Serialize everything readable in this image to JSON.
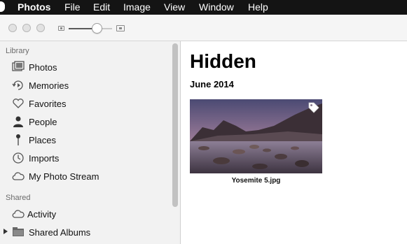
{
  "menubar": {
    "app_name": "Photos",
    "items": [
      "File",
      "Edit",
      "Image",
      "View",
      "Window",
      "Help"
    ]
  },
  "toolbar": {
    "zoom_level": 0.65
  },
  "sidebar": {
    "library_title": "Library",
    "library_items": [
      {
        "label": "Photos",
        "icon": "photos-icon"
      },
      {
        "label": "Memories",
        "icon": "memories-icon"
      },
      {
        "label": "Favorites",
        "icon": "heart-icon"
      },
      {
        "label": "People",
        "icon": "person-icon"
      },
      {
        "label": "Places",
        "icon": "pin-icon"
      },
      {
        "label": "Imports",
        "icon": "clock-icon"
      },
      {
        "label": "My Photo Stream",
        "icon": "cloud-icon"
      }
    ],
    "shared_title": "Shared",
    "shared_items": [
      {
        "label": "Activity",
        "icon": "cloud-icon"
      },
      {
        "label": "Shared Albums",
        "icon": "folder-icon"
      }
    ]
  },
  "main": {
    "title": "Hidden",
    "section_date": "June 2014",
    "photos": [
      {
        "caption": "Yosemite 5.jpg",
        "badge_icon": "tag-icon"
      }
    ]
  },
  "colors": {
    "menubar_bg": "#141414",
    "sidebar_bg": "#f2f2f2",
    "toolbar_bg": "#f5f5f5"
  }
}
